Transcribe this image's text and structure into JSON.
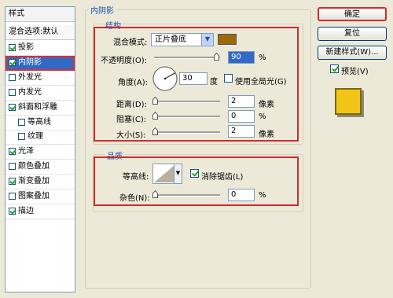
{
  "styles_panel": {
    "header": "样式",
    "blend_options": "混合选项:默认",
    "items": [
      {
        "label": "投影",
        "checked": true
      },
      {
        "label": "内阴影",
        "checked": true
      },
      {
        "label": "外发光",
        "checked": false
      },
      {
        "label": "内发光",
        "checked": false
      },
      {
        "label": "斜面和浮雕",
        "checked": true
      },
      {
        "label": "等高线",
        "checked": false
      },
      {
        "label": "纹理",
        "checked": false
      },
      {
        "label": "光泽",
        "checked": true
      },
      {
        "label": "颜色叠加",
        "checked": false
      },
      {
        "label": "渐变叠加",
        "checked": true
      },
      {
        "label": "图案叠加",
        "checked": false
      },
      {
        "label": "描边",
        "checked": true
      }
    ]
  },
  "inner_shadow": {
    "title": "内阴影",
    "structure": {
      "title": "结构",
      "blend_mode_label": "混合模式:",
      "blend_mode_value": "正片叠底",
      "color": "#9a6a0c",
      "opacity_label": "不透明度(O):",
      "opacity_value": "90",
      "opacity_unit": "%",
      "angle_label": "角度(A):",
      "angle_value": "30",
      "angle_unit": "度",
      "global_light_label": "使用全局光(G)",
      "global_light_checked": false,
      "distance_label": "距离(D):",
      "distance_value": "2",
      "distance_unit": "像素",
      "choke_label": "阻塞(C):",
      "choke_value": "0",
      "choke_unit": "%",
      "size_label": "大小(S):",
      "size_value": "2",
      "size_unit": "像素"
    },
    "quality": {
      "title": "品质",
      "contour_label": "等高线:",
      "anti_alias_label": "消除锯齿(L)",
      "anti_alias_checked": true,
      "noise_label": "杂色(N):",
      "noise_value": "0",
      "noise_unit": "%"
    }
  },
  "buttons": {
    "ok": "确定",
    "reset": "复位",
    "new_style": "新建样式(W)...",
    "preview_label": "预览(V)",
    "preview_checked": true
  },
  "preview_swatch": {
    "fill": "#f2c418",
    "border": "#7a6a10"
  }
}
